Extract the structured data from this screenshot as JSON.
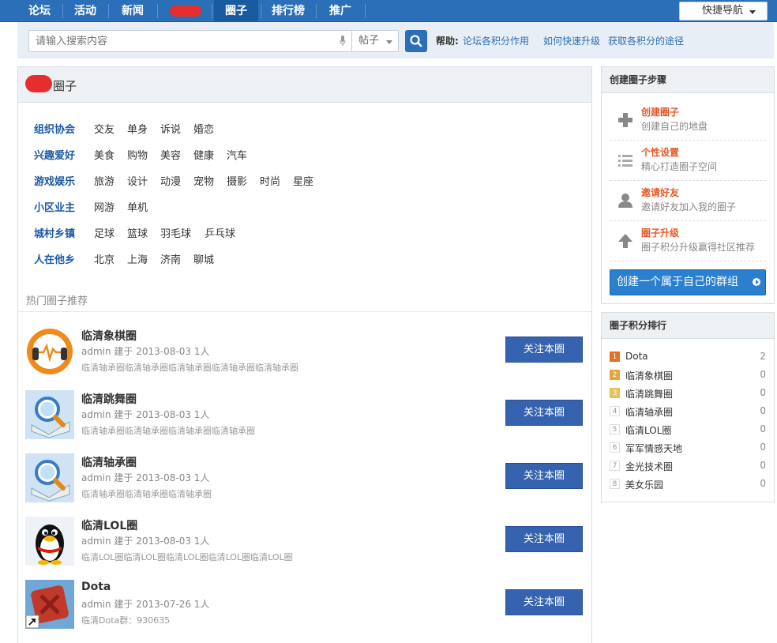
{
  "nav": {
    "items": [
      "论坛",
      "活动",
      "新闻",
      "",
      "圈子",
      "排行榜",
      "推广"
    ],
    "quick_nav": "快捷导航"
  },
  "search": {
    "placeholder": "请输入搜索内容",
    "type": "帖子",
    "help_label": "帮助:",
    "help_links": [
      "论坛各积分作用",
      "如何快速升级",
      "获取各积分的途径"
    ]
  },
  "main": {
    "title": "圈子",
    "categories": [
      {
        "name": "组织协会",
        "links": [
          "交友",
          "单身",
          "诉说",
          "婚恋"
        ]
      },
      {
        "name": "兴趣爱好",
        "links": [
          "美食",
          "购物",
          "美容",
          "健康",
          "汽车"
        ]
      },
      {
        "name": "游戏娱乐",
        "links": [
          "旅游",
          "设计",
          "动漫",
          "宠物",
          "摄影",
          "时尚",
          "星座"
        ]
      },
      {
        "name": "小区业主",
        "links": [
          "网游",
          "单机"
        ]
      },
      {
        "name": "城村乡镇",
        "links": [
          "足球",
          "篮球",
          "羽毛球",
          "乒乓球"
        ]
      },
      {
        "name": "人在他乡",
        "links": [
          "北京",
          "上海",
          "济南",
          "聊城"
        ]
      }
    ],
    "hot_title": "热门圈子推荐",
    "groups": [
      {
        "name": "临清象棋圈",
        "meta": "admin 建于 2013-08-03 1人",
        "desc": "临清轴承圈临清轴承圈临清轴承圈临清轴承圈临清轴承圈",
        "icon": "audio-icon",
        "follow": "关注本圈"
      },
      {
        "name": "临清跳舞圈",
        "meta": "admin 建于 2013-08-03 1人",
        "desc": "临清轴承圈临清轴承圈临清轴承圈临清轴承圈",
        "icon": "search-magnifier-icon",
        "follow": "关注本圈"
      },
      {
        "name": "临清轴承圈",
        "meta": "admin 建于 2013-08-03 1人",
        "desc": "临清轴承圈临清轴承圈临清轴承圈",
        "icon": "search-magnifier-icon",
        "follow": "关注本圈"
      },
      {
        "name": "临清LOL圈",
        "meta": "admin 建于 2013-08-03 1人",
        "desc": "临清LOL圈临清LOL圈临清LOL圈临清LOL圈临清LOL圈",
        "icon": "penguin-icon",
        "follow": "关注本圈"
      },
      {
        "name": "Dota",
        "meta": "admin 建于 2013-07-26 1人",
        "desc": "临清Dota群：930635",
        "icon": "dota-icon",
        "follow": "关注本圈"
      }
    ]
  },
  "sidebar": {
    "steps_title": "创建圈子步骤",
    "steps": [
      {
        "title": "创建圈子",
        "desc": "创建自己的地盘",
        "icon": "plus-icon"
      },
      {
        "title": "个性设置",
        "desc": "精心打造圈子空间",
        "icon": "list-icon"
      },
      {
        "title": "邀请好友",
        "desc": "邀请好友加入我的圈子",
        "icon": "user-icon"
      },
      {
        "title": "圈子升级",
        "desc": "圈子积分升级赢得社区推荐",
        "icon": "arrow-up-icon"
      }
    ],
    "create_button": "创建一个属于自己的群组",
    "rank_title": "圈子积分排行",
    "rank": [
      {
        "pos": "1",
        "name": "Dota",
        "score": "2"
      },
      {
        "pos": "2",
        "name": "临清象棋圈",
        "score": "0"
      },
      {
        "pos": "3",
        "name": "临清跳舞圈",
        "score": "0"
      },
      {
        "pos": "4",
        "name": "临清轴承圈",
        "score": "0"
      },
      {
        "pos": "5",
        "name": "临清LOL圈",
        "score": "0"
      },
      {
        "pos": "6",
        "name": "军军情感天地",
        "score": "0"
      },
      {
        "pos": "7",
        "name": "金光技术圈",
        "score": "0"
      },
      {
        "pos": "8",
        "name": "美女乐园",
        "score": "0"
      }
    ],
    "colors": {
      "rank1": "#e2712a",
      "rank2": "#e4a53a",
      "rank3": "#e8c25a"
    }
  }
}
